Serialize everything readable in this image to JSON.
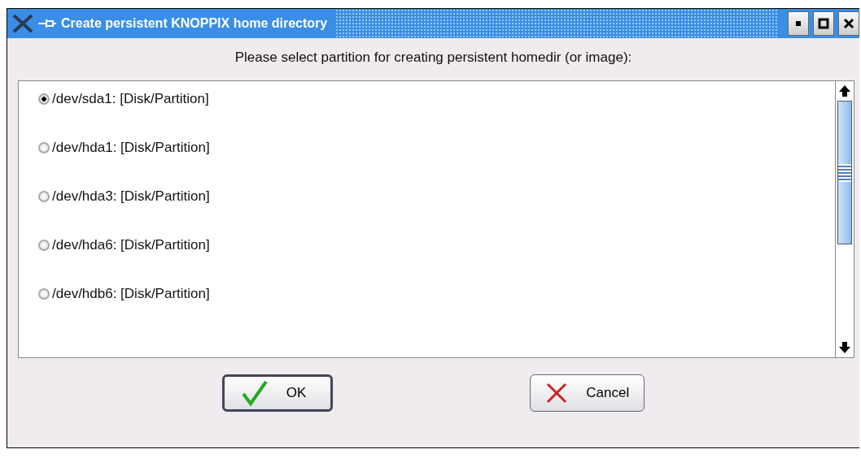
{
  "window": {
    "title": "Create persistent KNOPPIX home directory"
  },
  "prompt": "Please select partition for creating persistent homedir (or image):",
  "options": [
    {
      "label": "/dev/sda1: [Disk/Partition]",
      "selected": true
    },
    {
      "label": "/dev/hda1: [Disk/Partition]",
      "selected": false
    },
    {
      "label": "/dev/hda3: [Disk/Partition]",
      "selected": false
    },
    {
      "label": "/dev/hda6: [Disk/Partition]",
      "selected": false
    },
    {
      "label": "/dev/hdb6: [Disk/Partition]",
      "selected": false
    }
  ],
  "buttons": [
    {
      "kind": "ok",
      "label": "OK",
      "default": true
    },
    {
      "kind": "cancel",
      "label": "Cancel",
      "default": false
    }
  ]
}
